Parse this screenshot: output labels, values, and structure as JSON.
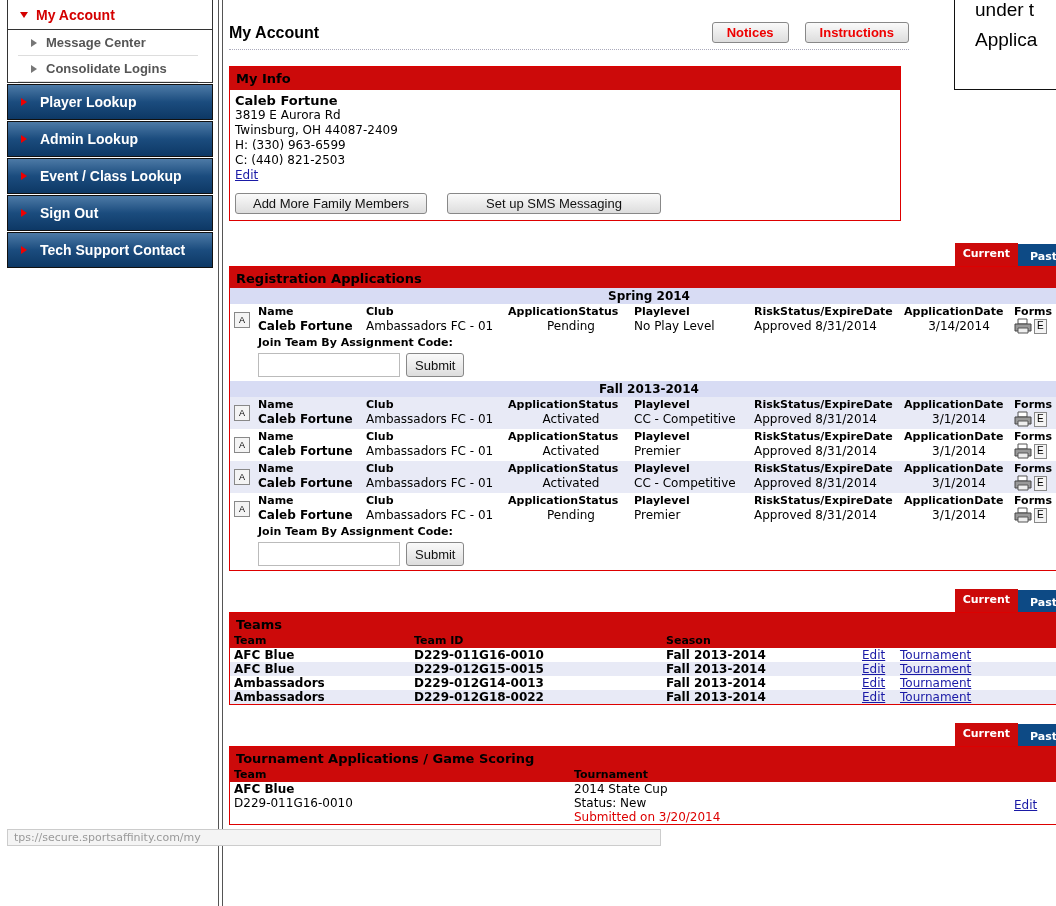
{
  "sidebar": {
    "items": [
      {
        "label": "My Account",
        "kind": "open",
        "selected": true,
        "children": [
          {
            "label": "Message Center"
          },
          {
            "label": "Consolidate Logins"
          }
        ]
      },
      {
        "label": "Player Lookup",
        "kind": "bar",
        "selected": false
      },
      {
        "label": "Admin Lookup",
        "kind": "bar",
        "selected": false
      },
      {
        "label": "Event / Class Lookup",
        "kind": "bar",
        "selected": false
      },
      {
        "label": "Sign Out",
        "kind": "bar",
        "selected": false
      },
      {
        "label": "Tech Support Contact",
        "kind": "bar",
        "selected": false
      }
    ]
  },
  "page_title": "My Account",
  "header_buttons": [
    "Notices",
    "Instructions"
  ],
  "callout": {
    "lines": [
      "under t",
      "Applica"
    ]
  },
  "my_info": {
    "title": "My Info",
    "name": "Caleb Fortune",
    "lines": [
      "3819 E Aurora Rd",
      "Twinsburg, OH 44087-2409",
      "H: (330) 963-6599",
      "C: (440) 821-2503"
    ],
    "edit_link": "Edit",
    "buttons": [
      "Add More Family Members",
      "Set up SMS Messaging"
    ]
  },
  "registration": {
    "tabs": [
      {
        "label": "Current",
        "selected": true
      },
      {
        "label": "Past",
        "selected": false
      }
    ],
    "title": "Registration Applications",
    "seasons": [
      {
        "name": "Spring 2014",
        "rows": [
          {
            "a": "A",
            "headers": [
              "Name",
              "Club",
              "ApplicationStatus",
              "Playlevel",
              "RiskStatus/ExpireDate",
              "ApplicationDate",
              "Forms"
            ],
            "name": "Caleb Fortune",
            "club": "Ambassadors FC - 01",
            "status": "Pending",
            "playlevel": "No Play Level",
            "risk": "Approved 8/31/2014",
            "date": "3/14/2014",
            "e": "E",
            "join": {
              "label": "Join Team By Assignment Code:",
              "submit": "Submit"
            }
          }
        ]
      },
      {
        "name": "Fall 2013-2014",
        "rows": [
          {
            "a": "A",
            "headers": [
              "Name",
              "Club",
              "ApplicationStatus",
              "Playlevel",
              "RiskStatus/ExpireDate",
              "ApplicationDate",
              "Forms"
            ],
            "name": "Caleb Fortune",
            "club": "Ambassadors FC - 01",
            "status": "Activated",
            "playlevel": "CC - Competitive",
            "risk": "Approved 8/31/2014",
            "date": "3/1/2014",
            "e": "E"
          },
          {
            "a": "A",
            "headers": [
              "Name",
              "Club",
              "ApplicationStatus",
              "Playlevel",
              "RiskStatus/ExpireDate",
              "ApplicationDate",
              "Forms"
            ],
            "name": "Caleb Fortune",
            "club": "Ambassadors FC - 01",
            "status": "Activated",
            "playlevel": "Premier",
            "risk": "Approved 8/31/2014",
            "date": "3/1/2014",
            "e": "E"
          },
          {
            "a": "A",
            "headers": [
              "Name",
              "Club",
              "ApplicationStatus",
              "Playlevel",
              "RiskStatus/ExpireDate",
              "ApplicationDate",
              "Forms"
            ],
            "name": "Caleb Fortune",
            "club": "Ambassadors FC - 01",
            "status": "Activated",
            "playlevel": "CC - Competitive",
            "risk": "Approved 8/31/2014",
            "date": "3/1/2014",
            "e": "E"
          },
          {
            "a": "A",
            "headers": [
              "Name",
              "Club",
              "ApplicationStatus",
              "Playlevel",
              "RiskStatus/ExpireDate",
              "ApplicationDate",
              "Forms"
            ],
            "name": "Caleb Fortune",
            "club": "Ambassadors FC - 01",
            "status": "Pending",
            "playlevel": "Premier",
            "risk": "Approved 8/31/2014",
            "date": "3/1/2014",
            "e": "E",
            "join": {
              "label": "Join Team By Assignment Code:",
              "submit": "Submit"
            }
          }
        ]
      }
    ]
  },
  "teams": {
    "tabs": [
      {
        "label": "Current",
        "selected": true
      },
      {
        "label": "Past",
        "selected": false
      }
    ],
    "title": "Teams",
    "columns": [
      "Team",
      "Team ID",
      "Season"
    ],
    "rows": [
      {
        "team": "AFC Blue",
        "id": "D229-011G16-0010",
        "season": "Fall 2013-2014",
        "edit": "Edit",
        "tournament": "Tournament"
      },
      {
        "team": "AFC Blue",
        "id": "D229-012G15-0015",
        "season": "Fall 2013-2014",
        "edit": "Edit",
        "tournament": "Tournament"
      },
      {
        "team": "Ambassadors",
        "id": "D229-012G14-0013",
        "season": "Fall 2013-2014",
        "edit": "Edit",
        "tournament": "Tournament"
      },
      {
        "team": "Ambassadors",
        "id": "D229-012G18-0022",
        "season": "Fall 2013-2014",
        "edit": "Edit",
        "tournament": "Tournament"
      }
    ]
  },
  "tournaments": {
    "tabs": [
      {
        "label": "Current",
        "selected": true
      },
      {
        "label": "Past",
        "selected": false
      }
    ],
    "title": "Tournament Applications / Game Scoring",
    "columns": [
      "Team",
      "Tournament"
    ],
    "rows": [
      {
        "team": "AFC Blue",
        "team_id": "D229-011G16-0010",
        "tournament": "2014 State Cup",
        "status": "Status: New",
        "submitted": "Submitted on 3/20/2014",
        "edit": "Edit"
      }
    ]
  },
  "status_bar": {
    "url": "tps://secure.sportsaffinity.com/my"
  }
}
